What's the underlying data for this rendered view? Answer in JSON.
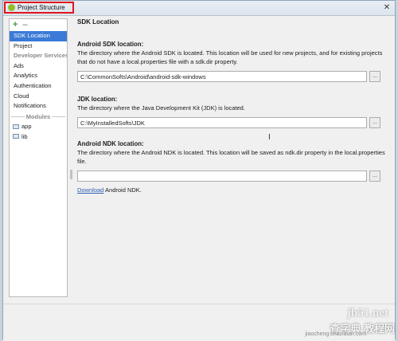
{
  "window": {
    "title": "Project Structure",
    "close_glyph": "✕"
  },
  "toolbar": {
    "add_glyph": "+",
    "remove_glyph": "–"
  },
  "sidebar": {
    "items_top": [
      {
        "label": "SDK Location"
      },
      {
        "label": "Project"
      }
    ],
    "developer_services_header": "Developer Services",
    "services": [
      {
        "label": "Ads"
      },
      {
        "label": "Analytics"
      },
      {
        "label": "Authentication"
      },
      {
        "label": "Cloud"
      },
      {
        "label": "Notifications"
      }
    ],
    "modules_header": "Modules",
    "modules": [
      {
        "label": "app"
      },
      {
        "label": "lib"
      }
    ]
  },
  "main": {
    "section_title": "SDK Location",
    "sdk": {
      "label": "Android SDK location:",
      "description": "The directory where the Android SDK is located. This location will be used for new projects, and for existing projects that do not have a local.properties file with a sdk.dir property.",
      "value": "C:\\CommonSofts\\Android\\android-sdk-windows"
    },
    "jdk": {
      "label": "JDK location:",
      "description": "The directory where the Java Development Kit (JDK) is located.",
      "value": "C:\\MyInstalledSofts\\JDK"
    },
    "ndk": {
      "label": "Android NDK location:",
      "description": "The directory where the Android NDK is located. This location will be saved as ndk.dir property in the local.properties file.",
      "value": ""
    },
    "browse_label": "...",
    "download_link": "Download",
    "download_suffix": " Android NDK."
  },
  "watermark": {
    "line1": "jb51.net",
    "line2": "查字典 教程网",
    "line3": "jiaocheng.chazidian.com"
  },
  "colors": {
    "selection": "#3b7ad7",
    "title_highlight": "#e0151d",
    "link": "#2d5fb8"
  }
}
